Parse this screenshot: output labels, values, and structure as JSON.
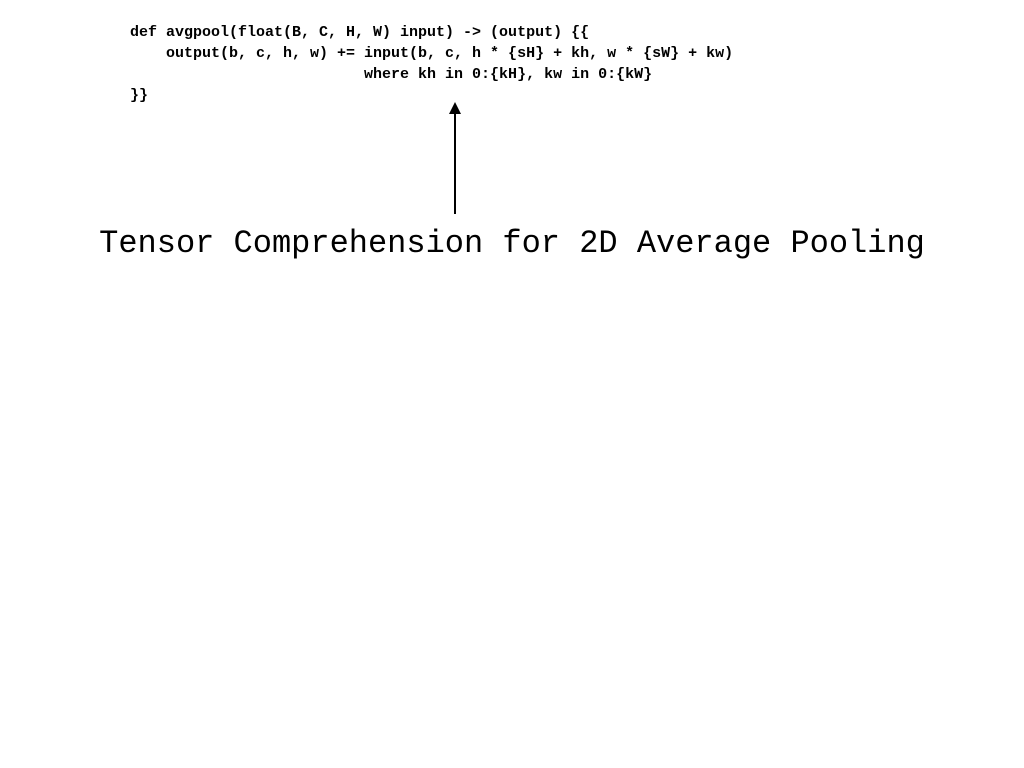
{
  "code": {
    "line1": "def avgpool(float(B, C, H, W) input) -> (output) {{",
    "line2": "    output(b, c, h, w) += input(b, c, h * {sH} + kh, w * {sW} + kw)",
    "line3": "                          where kh in 0:{kH}, kw in 0:{kW}",
    "line4": "}}"
  },
  "caption": "Tensor Comprehension for 2D Average Pooling"
}
